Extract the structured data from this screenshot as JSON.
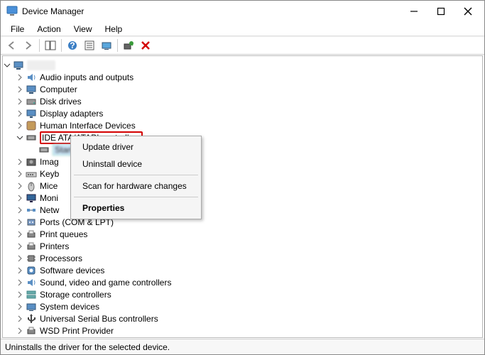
{
  "title": "Device Manager",
  "menu": {
    "file": "File",
    "action": "Action",
    "view": "View",
    "help": "Help"
  },
  "toolbar": {
    "back": "←",
    "forward": "→"
  },
  "root": {
    "label_hidden": "(PC name)"
  },
  "categories": [
    {
      "label": "Audio inputs and outputs",
      "icon": "audio",
      "expanded": false
    },
    {
      "label": "Computer",
      "icon": "computer",
      "expanded": false
    },
    {
      "label": "Disk drives",
      "icon": "drive",
      "expanded": false
    },
    {
      "label": "Display adapters",
      "icon": "display",
      "expanded": false
    },
    {
      "label": "Human Interface Devices",
      "icon": "hid",
      "expanded": false
    },
    {
      "label": "IDE ATA/ATAPI controllers",
      "icon": "ide",
      "expanded": true,
      "highlighted": true,
      "children": [
        {
          "label_hidden": "Standard controller",
          "selected": true
        }
      ]
    },
    {
      "label": "Imag",
      "icon": "imaging",
      "expanded": false,
      "cut": true
    },
    {
      "label": "Keyb",
      "icon": "keyboard",
      "expanded": false,
      "cut": true
    },
    {
      "label": "Mice",
      "icon": "mouse",
      "expanded": false,
      "cut": true
    },
    {
      "label": "Moni",
      "icon": "monitor",
      "expanded": false,
      "cut": true
    },
    {
      "label": "Netw",
      "icon": "network",
      "expanded": false,
      "cut": true
    },
    {
      "label": "Ports (COM & LPT)",
      "icon": "ports",
      "expanded": false
    },
    {
      "label": "Print queues",
      "icon": "printer",
      "expanded": false
    },
    {
      "label": "Printers",
      "icon": "printer",
      "expanded": false
    },
    {
      "label": "Processors",
      "icon": "cpu",
      "expanded": false
    },
    {
      "label": "Software devices",
      "icon": "software",
      "expanded": false
    },
    {
      "label": "Sound, video and game controllers",
      "icon": "audio",
      "expanded": false
    },
    {
      "label": "Storage controllers",
      "icon": "storage",
      "expanded": false
    },
    {
      "label": "System devices",
      "icon": "system",
      "expanded": false
    },
    {
      "label": "Universal Serial Bus controllers",
      "icon": "usb",
      "expanded": false
    },
    {
      "label": "WSD Print Provider",
      "icon": "printer",
      "expanded": false
    }
  ],
  "context_menu": {
    "update": "Update driver",
    "uninstall": "Uninstall device",
    "scan": "Scan for hardware changes",
    "properties": "Properties"
  },
  "status": "Uninstalls the driver for the selected device."
}
